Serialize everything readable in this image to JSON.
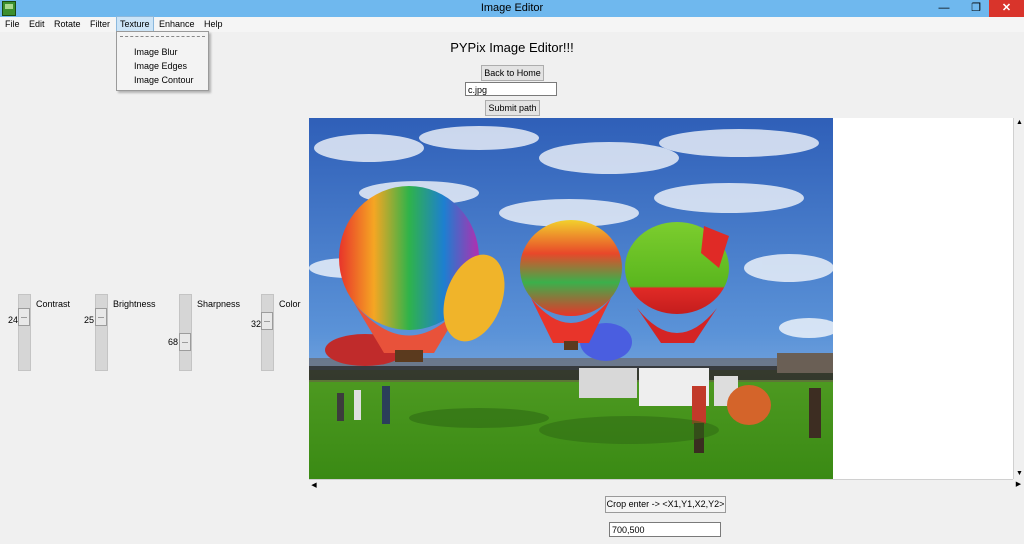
{
  "window": {
    "title": "Image Editor",
    "minimize_glyph": "—",
    "restore_glyph": "❐",
    "close_glyph": "✕"
  },
  "menu": {
    "items": [
      "File",
      "Edit",
      "Rotate",
      "Filter",
      "Texture",
      "Enhance",
      "Help"
    ],
    "active": "Texture"
  },
  "texture_menu": {
    "items": [
      "Image Blur",
      "Image Edges",
      "Image Contour"
    ]
  },
  "header": {
    "heading": "PYPix Image Editor!!!",
    "back_button": "Back to Home",
    "path_value": "c.jpg",
    "submit_button": "Submit path"
  },
  "sliders": [
    {
      "label": "Contrast",
      "value": 24
    },
    {
      "label": "Brightness",
      "value": 25
    },
    {
      "label": "Sharpness",
      "value": 68
    },
    {
      "label": "Color",
      "value": 32
    }
  ],
  "scroll": {
    "up_glyph": "▲",
    "down_glyph": "▼",
    "left_glyph": "◀",
    "right_glyph": "▶"
  },
  "crop": {
    "label": "Crop enter -> <X1,Y1,X2,Y2>",
    "value": "700,500"
  },
  "colors": {
    "titlebar": "#6fb8ee",
    "close_button": "#d9342b",
    "menu_active": "#cce4f7",
    "sky": "#3f74c8",
    "grass": "#4a9a1e"
  }
}
